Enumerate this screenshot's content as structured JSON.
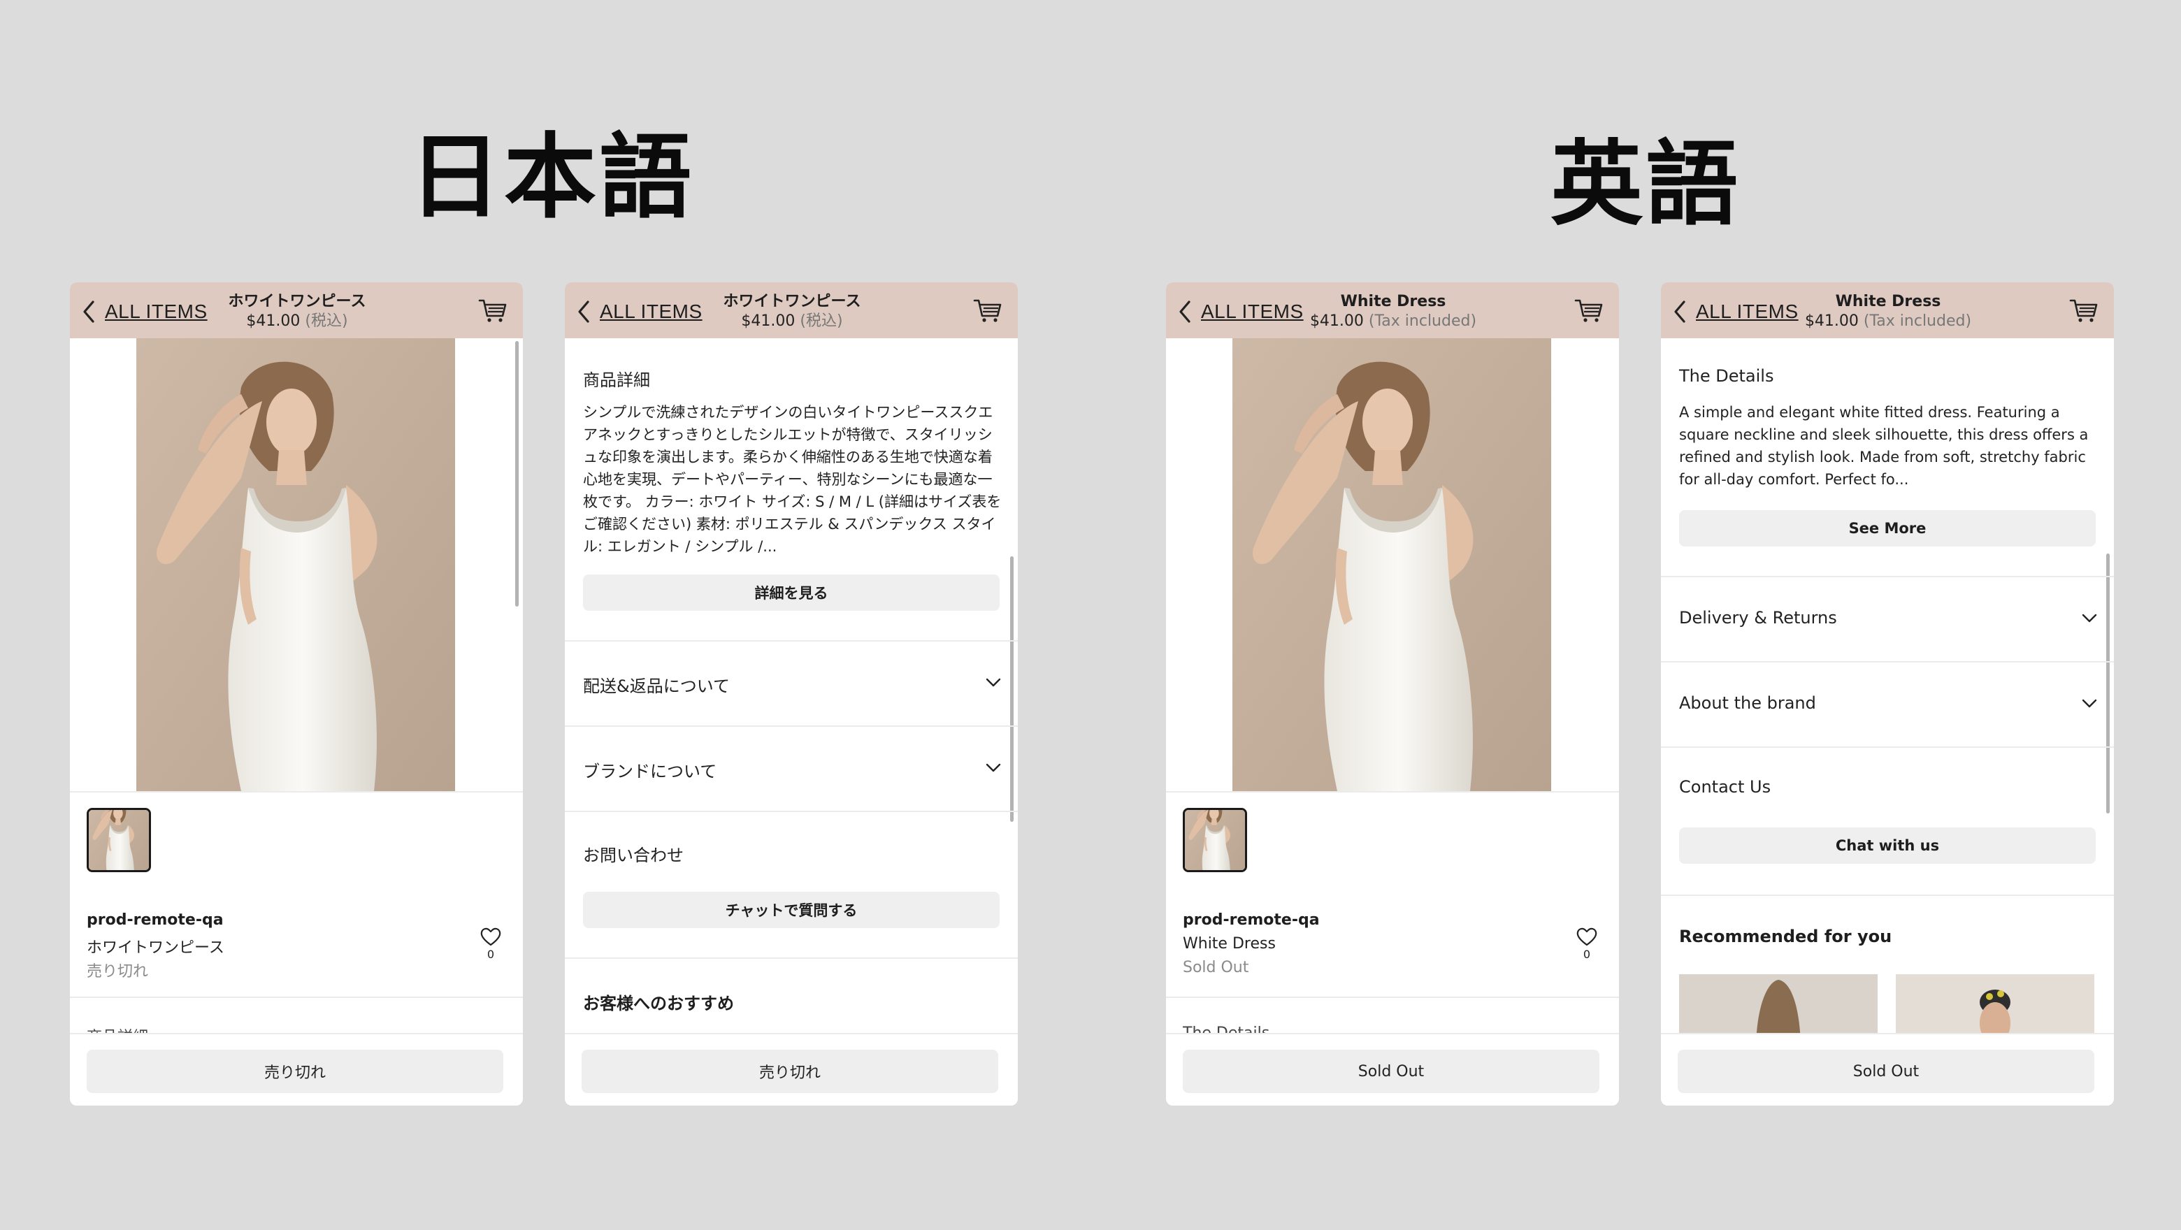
{
  "titles": {
    "japanese": "日本語",
    "english": "英語"
  },
  "colors": {
    "background": "#dcdcdc",
    "header": "#dfcac1",
    "button": "#eeeeee",
    "text": "#222222",
    "muted": "#8a8a8a"
  },
  "icons": {
    "back": "chevron-left-icon",
    "cart": "cart-icon",
    "favorite": "heart-icon",
    "expand": "chevron-down-icon"
  },
  "ja": {
    "header": {
      "back_label": "ALL ITEMS",
      "product_name": "ホワイトワンピース",
      "price": "$41.00",
      "tax_note": "(税込)"
    },
    "product": {
      "brand": "prod-remote-qa",
      "name": "ホワイトワンピース",
      "status": "売り切れ",
      "favorites": "0",
      "next_section_peek": "商品詳細"
    },
    "details": {
      "title": "商品詳細",
      "body": "シンプルで洗練されたデザインの白いタイトワンピーススクエアネックとすっきりとしたシルエットが特徴で、スタイリッシュな印象を演出します。柔らかく伸縮性のある生地で快適な着心地を実現、デートやパーティー、特別なシーンにも最適な一枚です。 カラー: ホワイト サイズ: S / M / L (詳細はサイズ表をご確認ください) 素材: ポリエステル & スパンデックス スタイル: エレガント / シンプル /...",
      "more_button": "詳細を見る"
    },
    "accordions": [
      "配送&返品について",
      "ブランドについて"
    ],
    "contact": {
      "title": "お問い合わせ",
      "button": "チャットで質問する"
    },
    "recommend_title": "お客様へのおすすめ",
    "footer_button": "売り切れ"
  },
  "en": {
    "header": {
      "back_label": "ALL ITEMS",
      "product_name": "White Dress",
      "price": "$41.00",
      "tax_note": "(Tax included)"
    },
    "product": {
      "brand": "prod-remote-qa",
      "name": "White Dress",
      "status": "Sold Out",
      "favorites": "0",
      "next_section_peek": "The Details"
    },
    "details": {
      "title": "The Details",
      "body": "A simple and elegant white fitted dress. Featuring a square neckline and sleek silhouette, this dress offers a refined and stylish look. Made from soft, stretchy fabric for all-day comfort. Perfect fo...",
      "more_button": "See More"
    },
    "accordions": [
      "Delivery & Returns",
      "About the brand"
    ],
    "contact": {
      "title": "Contact Us",
      "button": "Chat with us"
    },
    "recommend_title": "Recommended for you",
    "footer_button": "Sold Out"
  }
}
